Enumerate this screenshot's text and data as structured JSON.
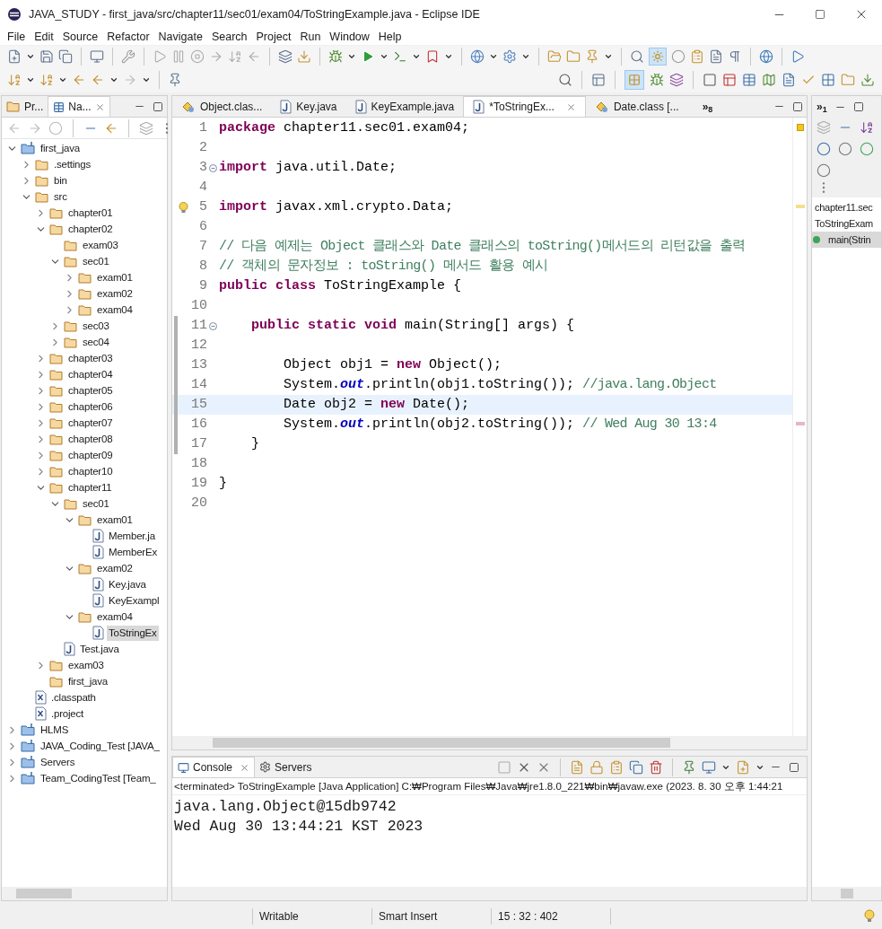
{
  "window": {
    "title": "JAVA_STUDY - first_java/src/chapter11/sec01/exam04/ToStringExample.java - Eclipse IDE"
  },
  "menu": [
    "File",
    "Edit",
    "Source",
    "Refactor",
    "Navigate",
    "Search",
    "Project",
    "Run",
    "Window",
    "Help"
  ],
  "left_panel": {
    "tabs": [
      {
        "label": "Pr...",
        "selected": false
      },
      {
        "label": "Na...",
        "selected": true
      }
    ],
    "tree": [
      {
        "label": "first_java",
        "kind": "project",
        "expanded": true,
        "selected": false,
        "children": [
          {
            "label": ".settings",
            "kind": "folder",
            "expanded": false,
            "selected": false
          },
          {
            "label": "bin",
            "kind": "folder",
            "expanded": false,
            "selected": false
          },
          {
            "label": "src",
            "kind": "folder",
            "expanded": true,
            "selected": false,
            "children": [
              {
                "label": "chapter01",
                "kind": "folder",
                "expanded": false,
                "selected": false
              },
              {
                "label": "chapter02",
                "kind": "folder",
                "expanded": true,
                "selected": false,
                "children": [
                  {
                    "label": "exam03",
                    "kind": "folder",
                    "selected": false
                  },
                  {
                    "label": "sec01",
                    "kind": "folder",
                    "expanded": true,
                    "selected": false,
                    "children": [
                      {
                        "label": "exam01",
                        "kind": "folder",
                        "expanded": false,
                        "selected": false
                      },
                      {
                        "label": "exam02",
                        "kind": "folder",
                        "expanded": false,
                        "selected": false
                      },
                      {
                        "label": "exam04",
                        "kind": "folder",
                        "expanded": false,
                        "selected": false
                      }
                    ]
                  },
                  {
                    "label": "sec03",
                    "kind": "folder",
                    "expanded": false,
                    "selected": false
                  },
                  {
                    "label": "sec04",
                    "kind": "folder",
                    "expanded": false,
                    "selected": false
                  }
                ]
              },
              {
                "label": "chapter03",
                "kind": "folder",
                "expanded": false,
                "selected": false
              },
              {
                "label": "chapter04",
                "kind": "folder",
                "expanded": false,
                "selected": false
              },
              {
                "label": "chapter05",
                "kind": "folder",
                "expanded": false,
                "selected": false
              },
              {
                "label": "chapter06",
                "kind": "folder",
                "expanded": false,
                "selected": false
              },
              {
                "label": "chapter07",
                "kind": "folder",
                "expanded": false,
                "selected": false
              },
              {
                "label": "chapter08",
                "kind": "folder",
                "expanded": false,
                "selected": false
              },
              {
                "label": "chapter09",
                "kind": "folder",
                "expanded": false,
                "selected": false
              },
              {
                "label": "chapter10",
                "kind": "folder",
                "expanded": false,
                "selected": false
              },
              {
                "label": "chapter11",
                "kind": "folder",
                "expanded": true,
                "selected": false,
                "children": [
                  {
                    "label": "sec01",
                    "kind": "folder",
                    "expanded": true,
                    "selected": false,
                    "children": [
                      {
                        "label": "exam01",
                        "kind": "folder",
                        "expanded": true,
                        "selected": false,
                        "children": [
                          {
                            "label": "Member.ja",
                            "kind": "java",
                            "selected": false
                          },
                          {
                            "label": "MemberEx",
                            "kind": "java",
                            "selected": false
                          }
                        ]
                      },
                      {
                        "label": "exam02",
                        "kind": "folder",
                        "expanded": true,
                        "selected": false,
                        "children": [
                          {
                            "label": "Key.java",
                            "kind": "java",
                            "selected": false
                          },
                          {
                            "label": "KeyExampl",
                            "kind": "java",
                            "selected": false
                          }
                        ]
                      },
                      {
                        "label": "exam04",
                        "kind": "folder",
                        "expanded": true,
                        "selected": false,
                        "children": [
                          {
                            "label": "ToStringEx",
                            "kind": "java",
                            "selected": true
                          }
                        ]
                      }
                    ]
                  },
                  {
                    "label": "Test.java",
                    "kind": "java",
                    "selected": false
                  }
                ]
              },
              {
                "label": "exam03",
                "kind": "folder",
                "expanded": false,
                "selected": false
              },
              {
                "label": "first_java",
                "kind": "folder",
                "selected": false
              }
            ]
          },
          {
            "label": ".classpath",
            "kind": "xml",
            "selected": false
          },
          {
            "label": ".project",
            "kind": "xml",
            "selected": false
          }
        ]
      },
      {
        "label": "HLMS",
        "kind": "project",
        "expanded": false,
        "selected": false
      },
      {
        "label": "JAVA_Coding_Test [JAVA_",
        "kind": "project",
        "expanded": false,
        "selected": false
      },
      {
        "label": "Servers",
        "kind": "project",
        "expanded": false,
        "selected": false
      },
      {
        "label": "Team_CodingTest [Team_",
        "kind": "project",
        "expanded": false,
        "selected": false
      }
    ]
  },
  "editor": {
    "tabs": [
      {
        "label": "Object.clas...",
        "kind": "class",
        "selected": false
      },
      {
        "label": "Key.java",
        "kind": "java",
        "selected": false
      },
      {
        "label": "KeyExample.java",
        "kind": "java",
        "selected": false
      },
      {
        "label": "*ToStringEx...",
        "kind": "java",
        "selected": true
      },
      {
        "label": "Date.class [...",
        "kind": "class",
        "selected": false
      }
    ],
    "overflow": "»$_{8}$",
    "lines": [
      {
        "number": "1",
        "current": false,
        "changed": false,
        "tokens": [
          {
            "kind": "keyword",
            "text": "package"
          },
          {
            "kind": "plain",
            "text": " chapter11.sec01.exam04;"
          }
        ]
      },
      {
        "number": "2",
        "current": false,
        "changed": false
      },
      {
        "number": "3",
        "fold": true,
        "current": false,
        "changed": false,
        "tokens": [
          {
            "kind": "keyword",
            "text": "import"
          },
          {
            "kind": "plain",
            "text": " java.util.Date;"
          }
        ]
      },
      {
        "number": "4",
        "current": false,
        "changed": false
      },
      {
        "number": "5",
        "warning": true,
        "current": false,
        "changed": false,
        "tokens": [
          {
            "kind": "keyword",
            "text": "import"
          },
          {
            "kind": "plain",
            "text": " javax.xml.crypto.Data;"
          }
        ]
      },
      {
        "number": "6",
        "current": false,
        "changed": false
      },
      {
        "number": "7",
        "current": false,
        "changed": false,
        "tokens": [
          {
            "kind": "comment",
            "text": "// 다음 예제는 Object 클래스와 Date 클래스의 toString()메서드의 리턴값을 출력"
          }
        ]
      },
      {
        "number": "8",
        "current": false,
        "changed": false,
        "tokens": [
          {
            "kind": "comment",
            "text": "// 객체의 문자정보 : toString() 메서드 활용 예시"
          }
        ]
      },
      {
        "number": "9",
        "current": false,
        "changed": false,
        "tokens": [
          {
            "kind": "keyword",
            "text": "public class"
          },
          {
            "kind": "plain",
            "text": " ToStringExample {"
          }
        ]
      },
      {
        "number": "10",
        "current": false,
        "changed": false
      },
      {
        "number": "11",
        "fold": true,
        "current": false,
        "changed": true,
        "tokens": [
          {
            "kind": "keyword",
            "text": "    public static void"
          },
          {
            "kind": "plain",
            "text": " main(String[] args) {"
          }
        ]
      },
      {
        "number": "12",
        "current": false,
        "changed": true
      },
      {
        "number": "13",
        "current": false,
        "changed": true,
        "tokens": [
          {
            "kind": "plain",
            "text": "        Object obj1 = "
          },
          {
            "kind": "keyword",
            "text": "new"
          },
          {
            "kind": "plain",
            "text": " Object();"
          }
        ]
      },
      {
        "number": "14",
        "current": false,
        "changed": true,
        "tokens": [
          {
            "kind": "plain",
            "text": "        System."
          },
          {
            "kind": "field",
            "text": "out"
          },
          {
            "kind": "plain",
            "text": ".println(obj1.toString()); "
          },
          {
            "kind": "comment",
            "text": "//java.lang.Object"
          }
        ]
      },
      {
        "number": "15",
        "current": true,
        "changed": true,
        "tokens": [
          {
            "kind": "plain",
            "text": "        Date obj2 = "
          },
          {
            "kind": "keyword",
            "text": "new"
          },
          {
            "kind": "plain",
            "text": " Date();"
          }
        ]
      },
      {
        "number": "16",
        "current": false,
        "changed": true,
        "tokens": [
          {
            "kind": "plain",
            "text": "        System."
          },
          {
            "kind": "field",
            "text": "out"
          },
          {
            "kind": "plain",
            "text": ".println(obj2.toString()); "
          },
          {
            "kind": "comment",
            "text": "// Wed Aug 30 13:4"
          }
        ]
      },
      {
        "number": "17",
        "current": false,
        "changed": true,
        "tokens": [
          {
            "kind": "plain",
            "text": "    }"
          }
        ]
      },
      {
        "number": "18",
        "current": false,
        "changed": false
      },
      {
        "number": "19",
        "current": false,
        "changed": false,
        "tokens": [
          {
            "kind": "plain",
            "text": "}"
          }
        ]
      },
      {
        "number": "20",
        "current": false,
        "changed": false
      }
    ]
  },
  "outline": {
    "overflow": "»$_{1}$",
    "items": [
      {
        "label": "chapter11.sec",
        "kind": "package",
        "selected": false
      },
      {
        "label": "ToStringExam",
        "kind": "class",
        "selected": false
      },
      {
        "label": "main(Strin",
        "kind": "method",
        "selected": true
      }
    ]
  },
  "console": {
    "tabs": [
      {
        "label": "Console",
        "selected": true
      },
      {
        "label": "Servers",
        "selected": false
      }
    ],
    "header": "<terminated> ToStringExample [Java Application] C:₩Program Files₩Java₩jre1.8.0_221₩bin₩javaw.exe  (2023. 8. 30 오후 1:44:21",
    "output": [
      "java.lang.Object@15db9742",
      "Wed Aug 30 13:44:21 KST 2023"
    ]
  },
  "status_bar": [
    "Writable",
    "Smart Insert",
    "15 : 32 : 402"
  ]
}
